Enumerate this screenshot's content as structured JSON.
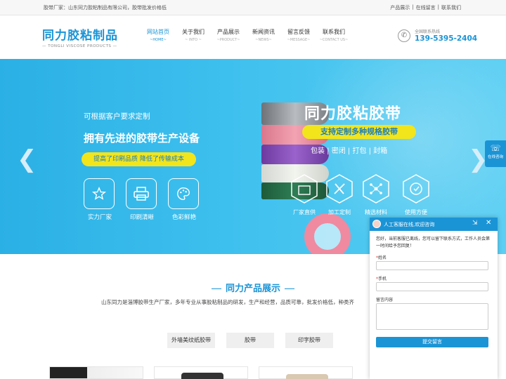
{
  "topbar": {
    "intro": "胶带厂家：山东同力胶粘制品有限公司，胶带批发价格低",
    "links": [
      "产品展示",
      "|",
      "在线留言",
      "|",
      "联系我们"
    ]
  },
  "logo": {
    "name": "同力胶粘制品",
    "sub": "— TONGLI VISCOSE PRODUCTS —"
  },
  "nav": [
    {
      "cn": "网站首页",
      "en": "~HOME~"
    },
    {
      "cn": "关于我们",
      "en": "~ INTO ~"
    },
    {
      "cn": "产品展示",
      "en": "~PRODUCT~"
    },
    {
      "cn": "新闻资讯",
      "en": "~NEWS~"
    },
    {
      "cn": "留言反馈",
      "en": "~MESSAGE~"
    },
    {
      "cn": "联系我们",
      "en": "~CONTACT US~"
    }
  ],
  "hotline": {
    "label": "全国联系热线",
    "number": "139-5395-2404"
  },
  "banner": {
    "line1": "可根据客户要求定制",
    "line2": "拥有先进的胶带生产设备",
    "pill": "提高了印刷品质  降低了传输成本",
    "features": [
      "实力厂家",
      "印刷清晰",
      "色彩鲜艳"
    ],
    "big_title": "同力胶粘胶带",
    "yellow_pill": "支持定制多种规格胶带",
    "small": "包装 | 密闭 | 打包 | 封箱",
    "hex_features": [
      "厂家直供",
      "加工定制",
      "精选材料",
      "使用方便"
    ]
  },
  "side_button": {
    "label": "在线咨询"
  },
  "products": {
    "title": "同力产品展示",
    "desc": "山东同力是淄博胶带生产厂家，多年专业从事胶粘制品的研发，生产和经营，品质可靠，批发价格低，种类齐",
    "tabs": [
      "外墙美纹纸胶带",
      "胶带",
      "印字胶带"
    ]
  },
  "chat": {
    "title": "人工客服在线,欢迎咨询",
    "message": "您好，当前客服已离线，您可以留下联系方式，工作人员会第一时间给予您回复！",
    "name_label": "姓名",
    "phone_label": "手机",
    "content_label": "留言内容",
    "required_mark": "*",
    "submit": "提交留言"
  },
  "colors": {
    "brand": "#1b94d6",
    "accent_yellow": "#f2e51c"
  }
}
